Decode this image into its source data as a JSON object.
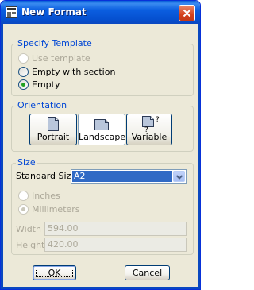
{
  "window": {
    "title": "New Format"
  },
  "template": {
    "legend": "Specify Template",
    "options": [
      {
        "label": "Use template",
        "state": "disabled"
      },
      {
        "label": "Empty with section",
        "state": "unchecked"
      },
      {
        "label": "Empty",
        "state": "checked"
      }
    ]
  },
  "orientation": {
    "legend": "Orientation",
    "buttons": [
      {
        "label": "Portrait",
        "icon": "portrait-page-icon"
      },
      {
        "label": "Landscape",
        "icon": "landscape-page-icon",
        "selected": true
      },
      {
        "label": "Variable",
        "icon": "variable-page-icon",
        "icon_mark": "?"
      }
    ]
  },
  "size": {
    "legend": "Size",
    "standard_label": "Standard Size",
    "standard_value": "A2",
    "units": [
      {
        "label": "Inches",
        "state": "disabled"
      },
      {
        "label": "Millimeters",
        "state": "disabled-checked"
      }
    ],
    "width_label": "Width",
    "width_value": "594.00",
    "height_label": "Height",
    "height_value": "420.00"
  },
  "buttons": {
    "ok": "OK",
    "cancel": "Cancel"
  },
  "colors": {
    "title_bar": "#0a5fd9",
    "dialog_bg": "#ece9d8",
    "legend": "#0046d5",
    "radio_check": "#21a121",
    "selection": "#316ac5"
  }
}
